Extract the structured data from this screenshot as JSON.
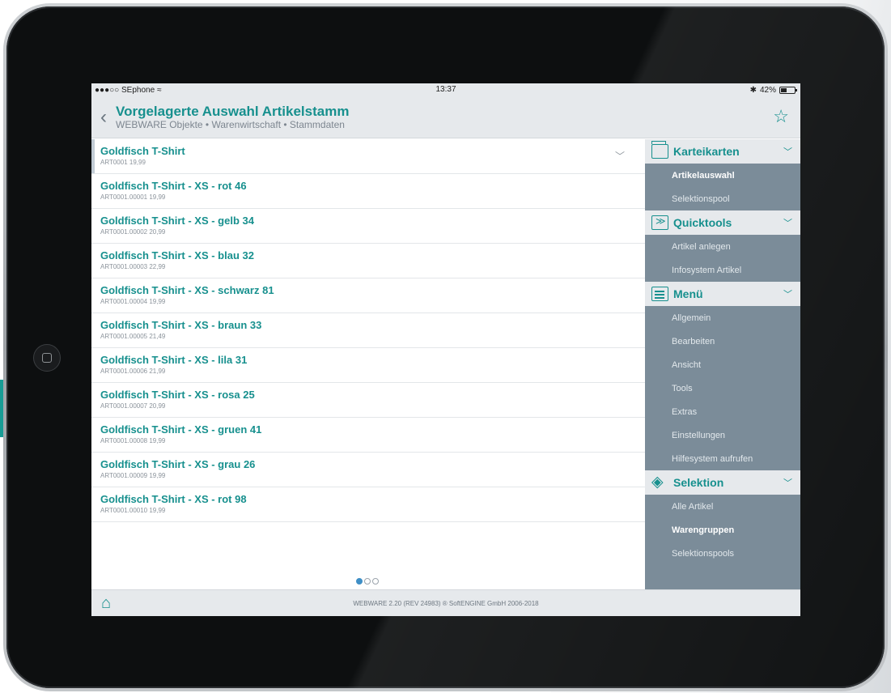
{
  "statusbar": {
    "carrier": "●●●○○ SEphone",
    "wifi": "≈",
    "time": "13:37",
    "bluetooth": "✱",
    "battery": "42%",
    "battery_level": 0.42
  },
  "header": {
    "title": "Vorgelagerte Auswahl Artikelstamm",
    "breadcrumb": "WEBWARE Objekte • Warenwirtschaft • Stammdaten",
    "back_icon": "chevron-left-icon",
    "star_icon": "star-outline-icon"
  },
  "list": [
    {
      "title": "Goldfisch T-Shirt",
      "sub": "ART0001 19,99"
    },
    {
      "title": "Goldfisch T-Shirt - XS - rot 46",
      "sub": "ART0001.00001 19,99"
    },
    {
      "title": "Goldfisch T-Shirt - XS - gelb 34",
      "sub": "ART0001.00002 20,99"
    },
    {
      "title": "Goldfisch T-Shirt - XS - blau 32",
      "sub": "ART0001.00003 22,99"
    },
    {
      "title": "Goldfisch T-Shirt - XS - schwarz 81",
      "sub": "ART0001.00004 19,99"
    },
    {
      "title": "Goldfisch T-Shirt - XS - braun 33",
      "sub": "ART0001.00005 21,49"
    },
    {
      "title": "Goldfisch T-Shirt - XS - lila 31",
      "sub": "ART0001.00006 21,99"
    },
    {
      "title": "Goldfisch T-Shirt - XS - rosa 25",
      "sub": "ART0001.00007 20,99"
    },
    {
      "title": "Goldfisch T-Shirt - XS - gruen 41",
      "sub": "ART0001.00008 19,99"
    },
    {
      "title": "Goldfisch T-Shirt - XS - grau 26",
      "sub": "ART0001.00009 19,99"
    },
    {
      "title": "Goldfisch T-Shirt - XS - rot 98",
      "sub": "ART0001.00010 19,99"
    }
  ],
  "sidebar": {
    "karteikarten": {
      "label": "Karteikarten",
      "items": [
        "Artikelauswahl",
        "Selektionspool"
      ]
    },
    "quicktools": {
      "label": "Quicktools",
      "items": [
        "Artikel anlegen",
        "Infosystem Artikel"
      ]
    },
    "menu": {
      "label": "Menü",
      "items": [
        "Allgemein",
        "Bearbeiten",
        "Ansicht",
        "Tools",
        "Extras",
        "Einstellungen",
        "Hilfesystem aufrufen"
      ]
    },
    "selektion": {
      "label": "Selektion",
      "items": [
        "Alle Artikel",
        "Warengruppen",
        "Selektionspools"
      ]
    }
  },
  "footer": {
    "text": "WEBWARE 2.20 (REV 24983) ® SoftENGINE GmbH 2006-2018",
    "home_icon": "home-icon"
  },
  "colors": {
    "accent": "#17908e",
    "sidebar": "#7b8c99",
    "teal_block": "#179c95"
  }
}
